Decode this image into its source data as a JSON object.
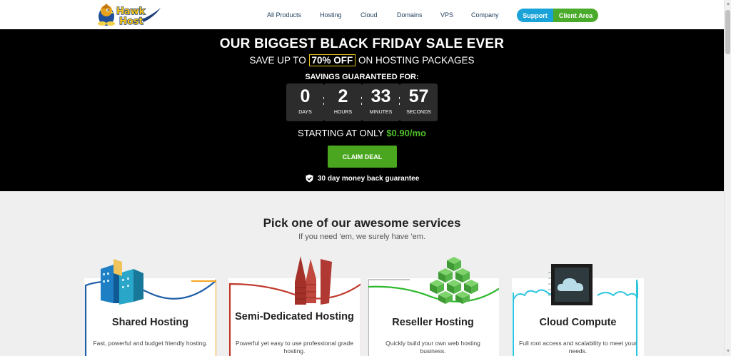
{
  "header": {
    "nav": [
      "All Products",
      "Hosting",
      "Cloud",
      "Domains",
      "VPS",
      "Company"
    ],
    "support_label": "Support",
    "client_label": "Client Area",
    "logo_text": "Hawk Host"
  },
  "promo": {
    "title": "OUR BIGGEST BLACK FRIDAY SALE EVER",
    "sub_before": "SAVE UP TO",
    "sub_highlight": "70% OFF",
    "sub_after": "ON HOSTING PACKAGES",
    "savings_label": "SAVINGS GUARANTEED FOR:",
    "countdown": [
      {
        "value": "0",
        "label": "DAYS"
      },
      {
        "value": "2",
        "label": "HOURS"
      },
      {
        "value": "33",
        "label": "MINUTES"
      },
      {
        "value": "57",
        "label": "SECONDS"
      }
    ],
    "starting_text": "STARTING AT ONLY",
    "starting_price": "$0.90/mo",
    "claim_label": "CLAIM DEAL",
    "guarantee": "30 day money back guarantee"
  },
  "services": {
    "title": "Pick one of our awesome services",
    "subtitle": "If you need 'em, we surely have 'em.",
    "cards": [
      {
        "title": "Shared Hosting",
        "desc": "Fast, powerful and budget friendly hosting.",
        "accent": "#f5a623",
        "accent2": "#1f5fa8"
      },
      {
        "title": "Semi-Dedicated Hosting",
        "desc": "Powerful yet easy to use professional grade hosting.",
        "accent": "#c0392b",
        "accent2": "#c0392b"
      },
      {
        "title": "Reseller Hosting",
        "desc": "Quickly build your own web hosting business.",
        "accent": "#2eb82e",
        "accent2": "#2eb82e"
      },
      {
        "title": "Cloud Compute",
        "desc": "Full root access and scalability to meet your needs.",
        "accent": "#2bc5e0",
        "accent2": "#2bc5e0"
      }
    ]
  },
  "colors": {
    "support": "#1aa3d9",
    "client_area": "#4aab2b",
    "price": "#4fbf2a",
    "claim": "#4aa61e",
    "highlight_border": "#e4c21b"
  }
}
